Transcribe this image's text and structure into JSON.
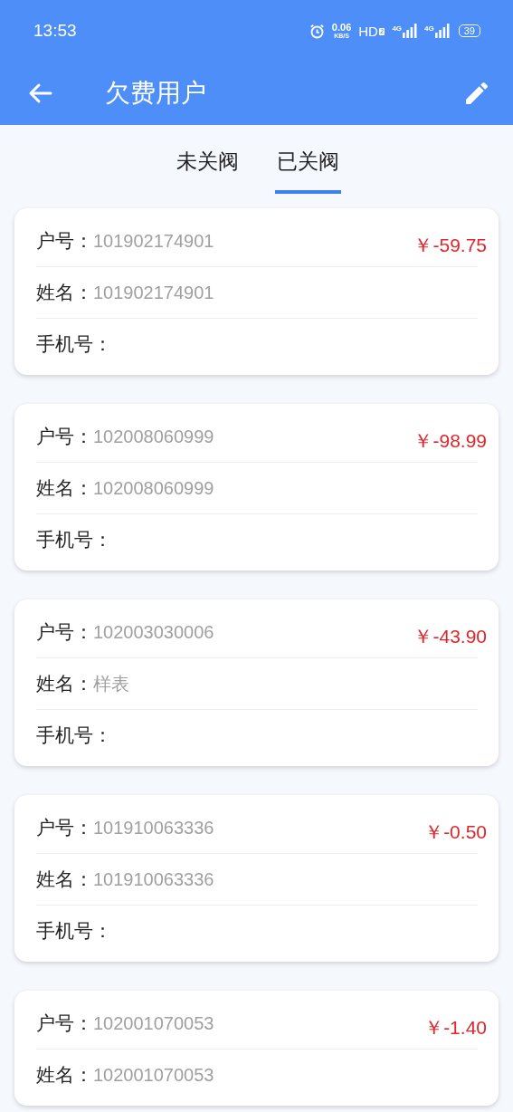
{
  "status_bar": {
    "time": "13:53",
    "speed": "0.06",
    "speed_unit": "KB/S",
    "hd": "HD",
    "hd_sub": "2",
    "networks": [
      "4G",
      "4G"
    ],
    "battery": "39"
  },
  "header": {
    "title": "欠费用户"
  },
  "tabs": [
    {
      "label": "未关阀",
      "selected": false
    },
    {
      "label": "已关阀",
      "selected": true
    }
  ],
  "cards": [
    {
      "amount": "￥-59.75",
      "fields": [
        {
          "label": "户号：",
          "value": "101902174901"
        },
        {
          "label": "姓名：",
          "value": "101902174901"
        },
        {
          "label": "手机号："
        }
      ]
    },
    {
      "amount": "￥-98.99",
      "fields": [
        {
          "label": "户号：",
          "value": "102008060999"
        },
        {
          "label": "姓名：",
          "value": "102008060999"
        },
        {
          "label": "手机号："
        }
      ]
    },
    {
      "amount": "￥-43.90",
      "fields": [
        {
          "label": "户号：",
          "value": "102003030006"
        },
        {
          "label": "姓名：",
          "value": "样表"
        },
        {
          "label": "手机号："
        }
      ]
    },
    {
      "amount": "￥-0.50",
      "fields": [
        {
          "label": "户号：",
          "value": "101910063336"
        },
        {
          "label": "姓名：",
          "value": "101910063336"
        },
        {
          "label": "手机号："
        }
      ]
    },
    {
      "amount": "￥-1.40",
      "fields": [
        {
          "label": "户号：",
          "value": "102001070053"
        },
        {
          "label": "姓名：",
          "value": "102001070053"
        }
      ]
    }
  ]
}
